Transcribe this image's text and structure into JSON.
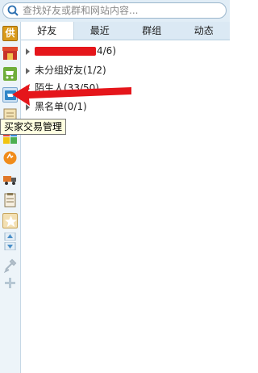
{
  "search": {
    "placeholder": "查找好友或群和网站内容..."
  },
  "tabs": [
    {
      "label": "好友",
      "active": true
    },
    {
      "label": "最近",
      "active": false
    },
    {
      "label": "群组",
      "active": false
    },
    {
      "label": "动态",
      "active": false
    }
  ],
  "groups": [
    {
      "label_visible": "4/6)",
      "redacted": true
    },
    {
      "label": "未分组好友(1/2)"
    },
    {
      "label": "陌生人(33/50)"
    },
    {
      "label": "黑名单(0/1)"
    }
  ],
  "rail": {
    "top_char": "供",
    "items": [
      {
        "icon": "shop-icon"
      },
      {
        "icon": "cart-icon"
      },
      {
        "icon": "buyer-trade-icon"
      },
      {
        "icon": "ledger-icon"
      },
      {
        "icon": "puzzle-icon"
      },
      {
        "icon": "orange-circle-icon"
      },
      {
        "icon": "delivery-truck-icon"
      },
      {
        "icon": "clipboard-icon"
      },
      {
        "icon": "star-icon"
      },
      {
        "icon": "scroll-up-icon"
      },
      {
        "icon": "scroll-down-icon"
      },
      {
        "icon": "tools-icon"
      },
      {
        "icon": "add-icon"
      }
    ]
  },
  "tooltip": {
    "text": "买家交易管理"
  },
  "colors": {
    "accent": "#e5161b",
    "rail_bg": "#edf4f9",
    "tab_bg": "#dbe9f4",
    "tooltip_bg": "#ffffe1"
  }
}
